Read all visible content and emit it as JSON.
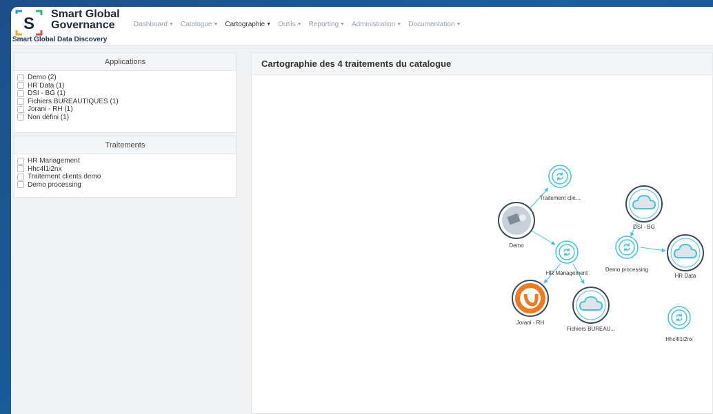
{
  "brand": {
    "logo_letter": "S",
    "title_line1": "Smart Global",
    "title_line2": "Governance",
    "subtitle": "Smart Global Data Discovery"
  },
  "nav": [
    {
      "label": "Dashboard",
      "active": false
    },
    {
      "label": "Catalogue",
      "active": false
    },
    {
      "label": "Cartographie",
      "active": true
    },
    {
      "label": "Outils",
      "active": false
    },
    {
      "label": "Reporting",
      "active": false
    },
    {
      "label": "Administration",
      "active": false
    },
    {
      "label": "Documentation",
      "active": false
    }
  ],
  "applications": {
    "title": "Applications",
    "items": [
      "Demo (2)",
      "HR Data (1)",
      "DSI - BG (1)",
      "Fichiers BUREAUTIQUES (1)",
      "Jorani - RH (1)",
      "Non défini (1)"
    ]
  },
  "traitements": {
    "title": "Traitements",
    "items": [
      "HR Management",
      "Hhc4l1i2nx",
      "Traitement clients demo",
      "Demo processing"
    ]
  },
  "main": {
    "title": "Cartographie des 4 traitements du catalogue"
  },
  "graph": {
    "nodes": {
      "traitement_clients": "Traitement clie...",
      "demo": "Demo",
      "hr_management": "HR Management",
      "jorani": "Jorani - RH",
      "fichiers": "Fichiers BUREAU...",
      "dsi_bg": "DSI - BG",
      "demo_processing": "Demo processing",
      "hr_data": "HR Data",
      "hhc": "Hhc4l1i2nx"
    }
  },
  "colors": {
    "accent_cyan": "#3cc4ea",
    "jorani_orange": "#f27a1a",
    "nav_inactive": "#9aa0a8"
  }
}
